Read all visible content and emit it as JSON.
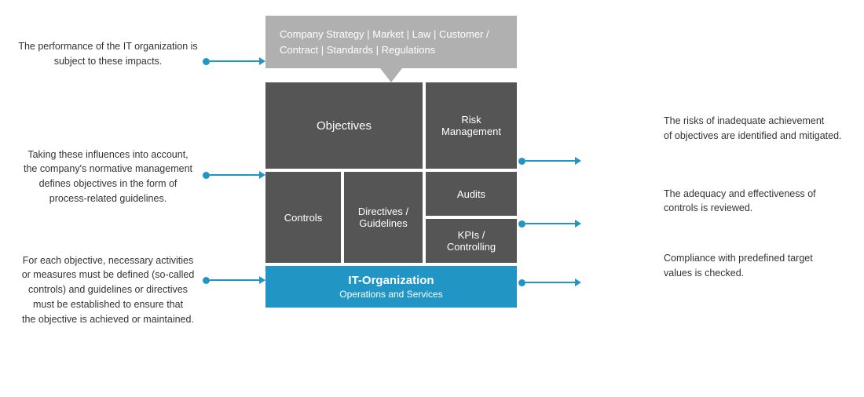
{
  "left": {
    "text1": "The performance of the IT organization is\nsubject to these impacts.",
    "text2": "Taking these influences into account,\nthe company's normative management\ndefines objectives in the form of\nprocess-related guidelines.",
    "text3": "For each objective, necessary activities\nor measures must be defined (so-called\ncontrols) and guidelines or directives\nmust be established to ensure that\nthe objective is achieved or maintained."
  },
  "right": {
    "text1": "The risks of inadequate achievement\nof objectives are identified and mitigated.",
    "text2": "The adequacy and effectiveness of\ncontrols is reviewed.",
    "text3": "Compliance with predefined target\nvalues is checked."
  },
  "diagram": {
    "strategy_box": "Company Strategy | Market | Law | Customer /\nContract | Standards | Regulations",
    "objectives_label": "Objectives",
    "risk_label": "Risk\nManagement",
    "controls_label": "Controls",
    "directives_label": "Directives /\nGuidelines",
    "audits_label": "Audits",
    "kpis_label": "KPIs /\nControlling",
    "it_org_title": "IT-Organization",
    "it_org_subtitle": "Operations and Services"
  },
  "colors": {
    "accent": "#2196c4",
    "block_bg": "#555555",
    "strategy_bg": "#b0b0b0",
    "it_org_bg": "#2196c4"
  }
}
